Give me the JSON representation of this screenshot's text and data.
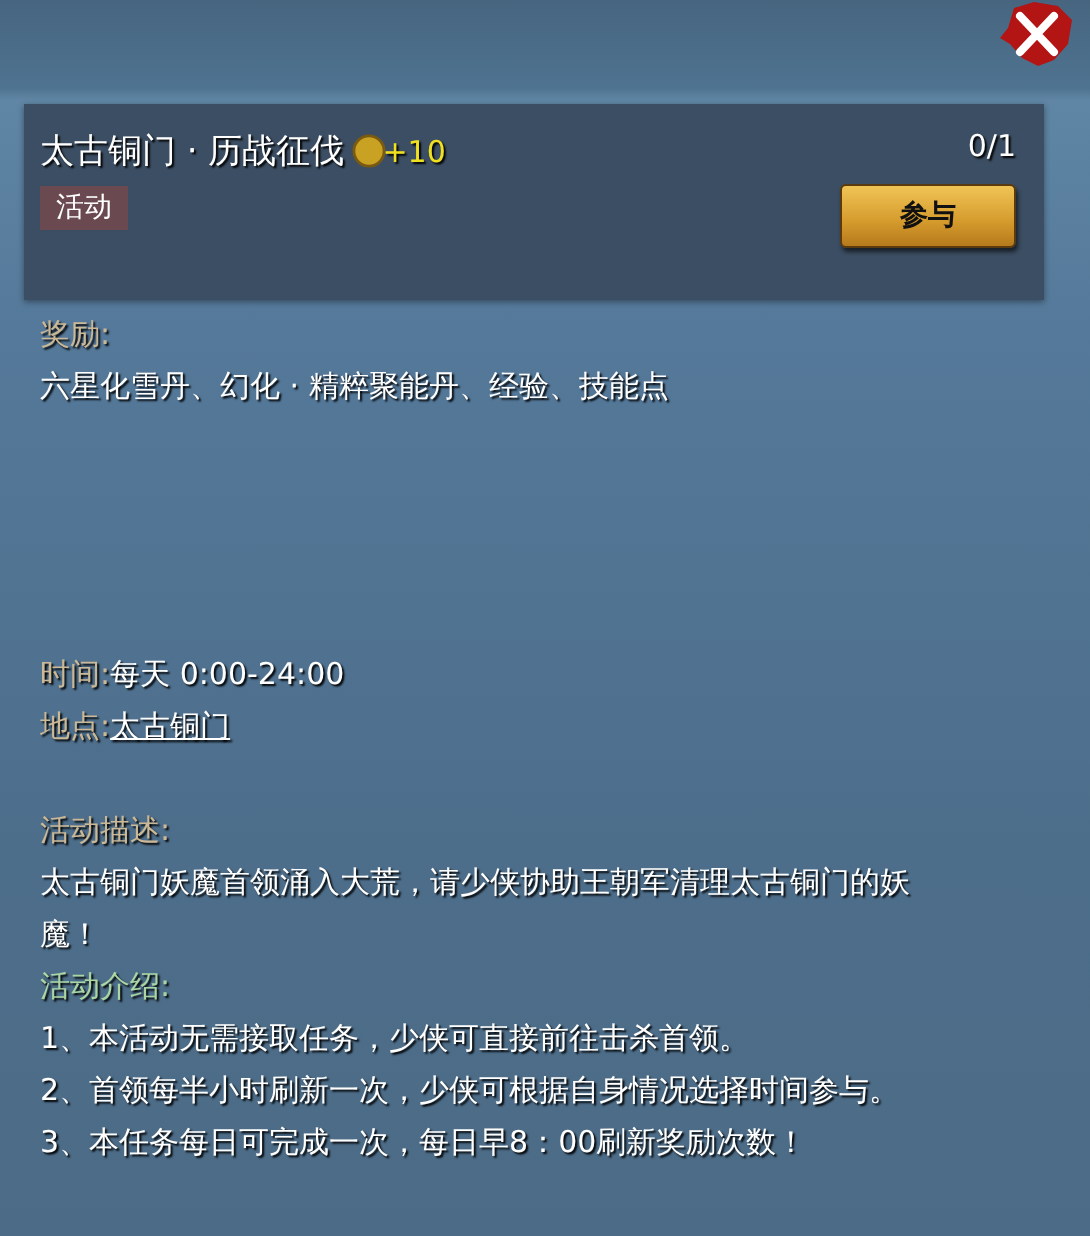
{
  "task": {
    "title": "太古铜门 · 历战征伐",
    "points": "+10",
    "progress": "0/1",
    "tag": "活动",
    "join_button": "参与"
  },
  "reward": {
    "label": "奖励:",
    "value": "六星化雪丹、幻化 · 精粹聚能丹、经验、技能点"
  },
  "time": {
    "label": "时间:",
    "value": "每天 0:00-24:00"
  },
  "location": {
    "label": "地点:",
    "value": "太古铜门"
  },
  "description": {
    "label": "活动描述:",
    "text": "太古铜门妖魔首领涌入大荒，请少侠协助王朝军清理太古铜门的妖魔！"
  },
  "introduction": {
    "label": "活动介绍:",
    "items": [
      "1、本活动无需接取任务，少侠可直接前往击杀首领。",
      "2、首领每半小时刷新一次，少侠可根据自身情况选择时间参与。",
      "3、本任务每日可完成一次，每日早8：00刷新奖励次数！"
    ]
  }
}
